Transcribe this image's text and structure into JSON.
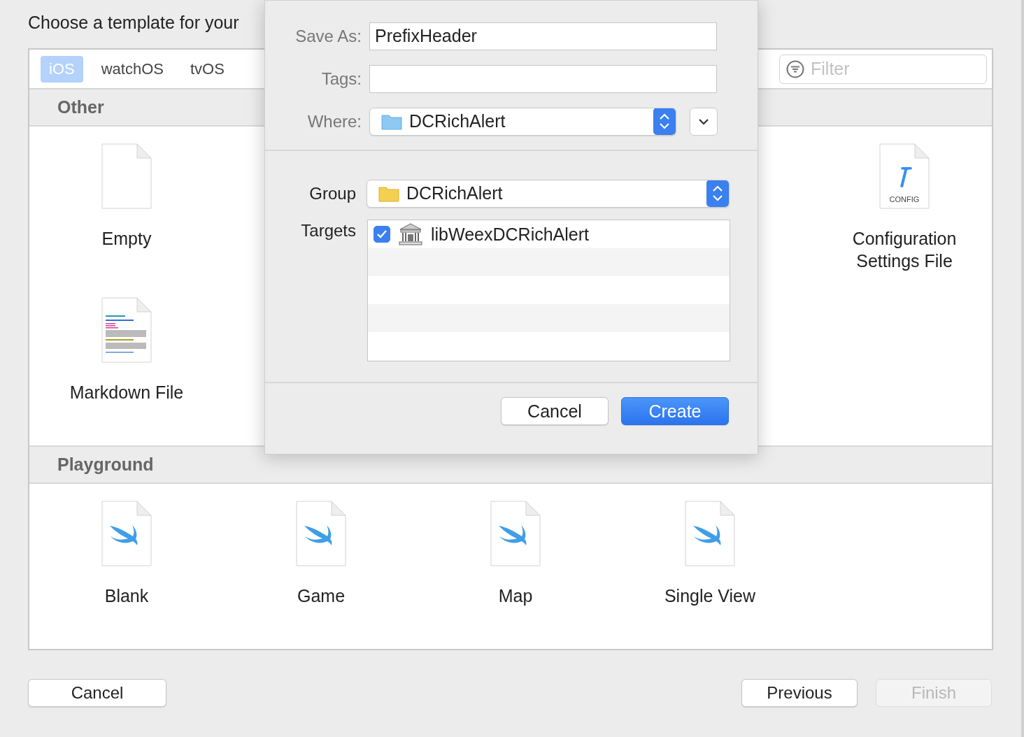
{
  "sheet": {
    "title": "Choose a template for your",
    "tabs": [
      {
        "label": "iOS",
        "selected": true
      },
      {
        "label": "watchOS",
        "selected": false
      },
      {
        "label": "tvOS",
        "selected": false
      }
    ],
    "filter": {
      "placeholder": "Filter"
    },
    "sections": [
      {
        "title": "Other",
        "items": [
          {
            "label": "Empty",
            "kind": "blank"
          },
          {
            "label": "Configuration Settings File",
            "kind": "config",
            "badge": "CONFIG"
          },
          {
            "label": "Markdown File",
            "kind": "markdown"
          }
        ]
      },
      {
        "title": "Playground",
        "items": [
          {
            "label": "Blank",
            "kind": "swift"
          },
          {
            "label": "Game",
            "kind": "swift"
          },
          {
            "label": "Map",
            "kind": "swift"
          },
          {
            "label": "Single View",
            "kind": "swift"
          }
        ]
      }
    ],
    "buttons": [
      {
        "label": "Cancel",
        "disabled": false
      },
      {
        "label": "Previous",
        "disabled": false
      },
      {
        "label": "Finish",
        "disabled": true
      }
    ]
  },
  "dialog": {
    "save_as": {
      "label": "Save As:",
      "value": "PrefixHeader"
    },
    "tags": {
      "label": "Tags:"
    },
    "where": {
      "label": "Where:",
      "value": "DCRichAlert"
    },
    "group": {
      "label": "Group",
      "value": "DCRichAlert"
    },
    "targets": {
      "label": "Targets",
      "items": [
        {
          "name": "libWeexDCRichAlert",
          "checked": true
        }
      ]
    },
    "buttons": [
      {
        "label": "Cancel",
        "primary": false
      },
      {
        "label": "Create",
        "primary": true
      }
    ]
  }
}
